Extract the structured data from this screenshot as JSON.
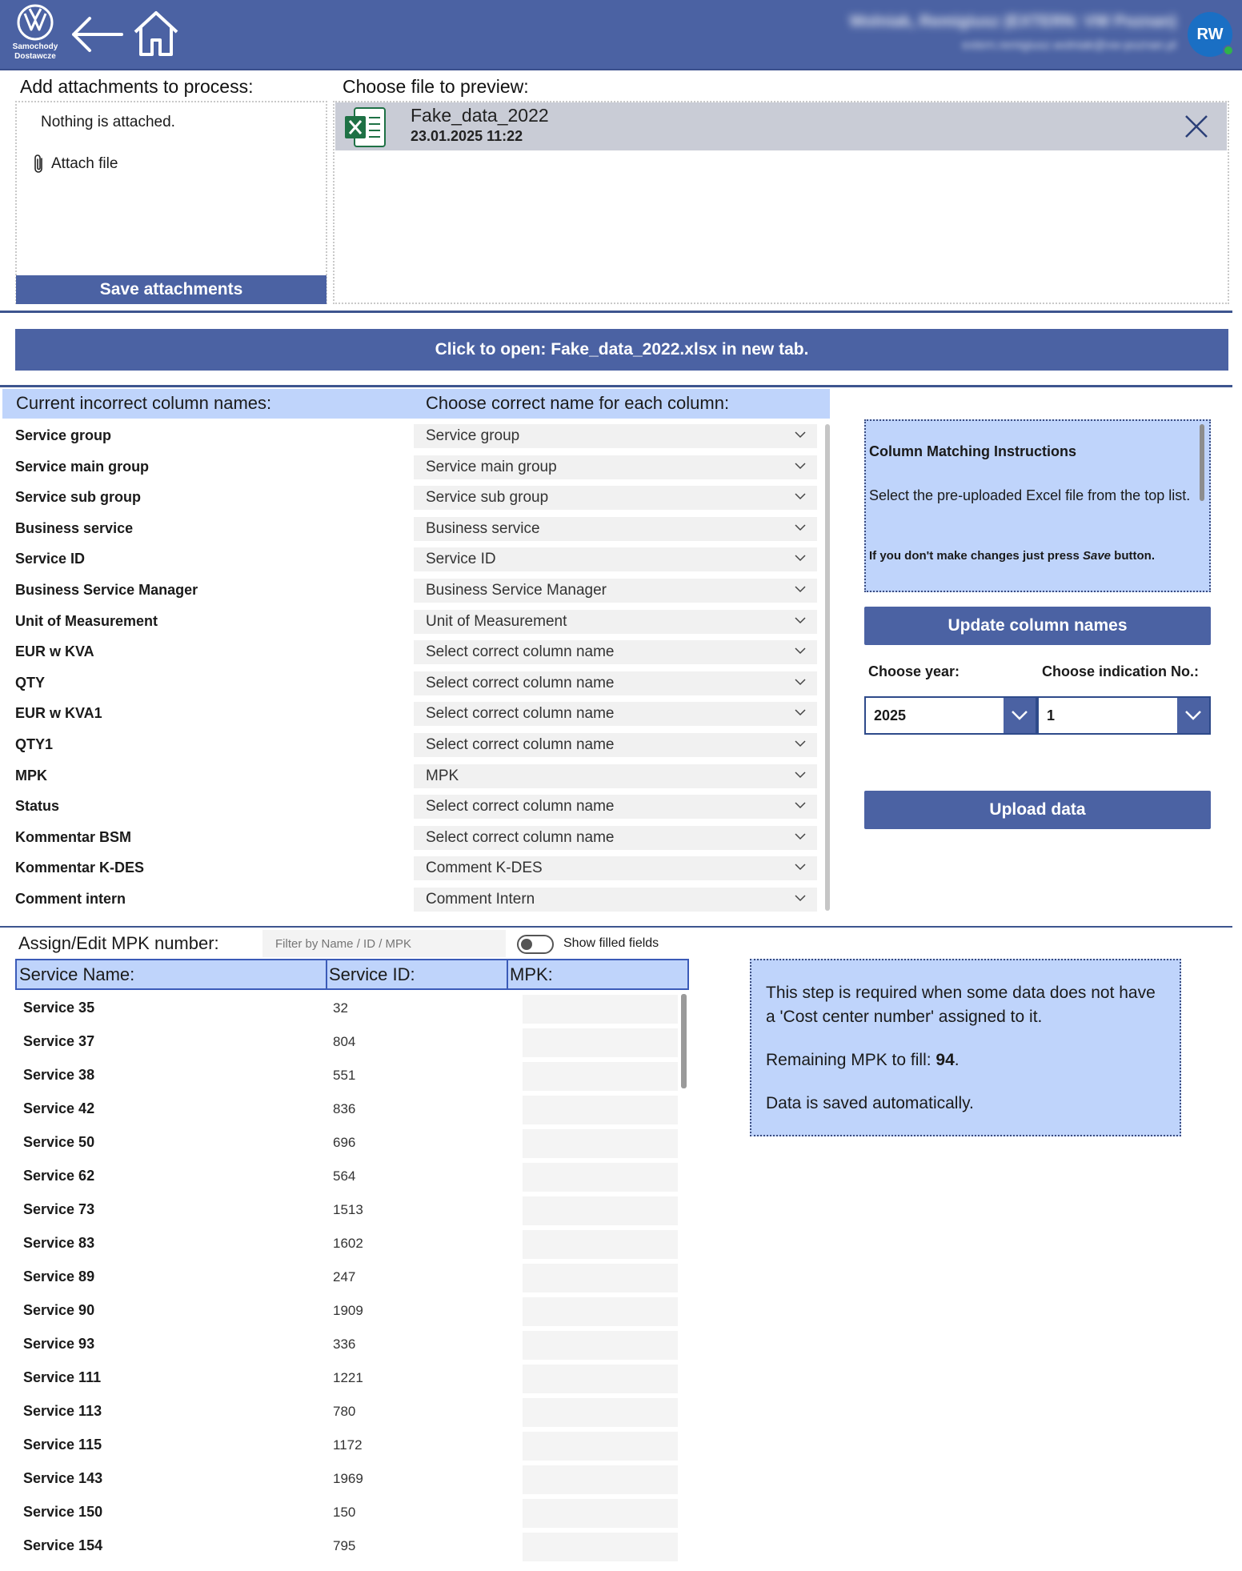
{
  "header": {
    "brand_line1": "Samochody",
    "brand_line2": "Dostawcze",
    "user_name": "Wolniak, Remigiusz (EXTERN: VW Poznan)",
    "user_email": "extern.remigiusz.wolniak@vw-poznan.pl",
    "avatar_initials": "RW",
    "color": "#4b62a3"
  },
  "attachments": {
    "label": "Add attachments to process:",
    "empty_text": "Nothing is attached.",
    "attach_label": "Attach file",
    "save_label": "Save attachments"
  },
  "preview": {
    "label": "Choose file to preview:",
    "file_name": "Fake_data_2022",
    "file_date": "23.01.2025 11:22",
    "open_button": "Click to open: Fake_data_2022.xlsx in new tab."
  },
  "mapping": {
    "header_current": "Current incorrect column names:",
    "header_choose": "Choose correct name for each column:",
    "rows": [
      {
        "current": "Service group",
        "choice": "Service group"
      },
      {
        "current": "Service main group",
        "choice": "Service main group"
      },
      {
        "current": "Service sub group",
        "choice": "Service sub group"
      },
      {
        "current": "Business service",
        "choice": "Business service"
      },
      {
        "current": "Service ID",
        "choice": "Service ID"
      },
      {
        "current": "Business Service Manager",
        "choice": "Business Service Manager"
      },
      {
        "current": "Unit of Measurement",
        "choice": "Unit of Measurement"
      },
      {
        "current": "EUR w KVA",
        "choice": "Select correct column name"
      },
      {
        "current": "QTY",
        "choice": "Select correct column name"
      },
      {
        "current": "EUR w KVA1",
        "choice": "Select correct column name"
      },
      {
        "current": "QTY1",
        "choice": "Select correct column name"
      },
      {
        "current": "MPK",
        "choice": "MPK"
      },
      {
        "current": "Status",
        "choice": "Select correct column name"
      },
      {
        "current": "Kommentar BSM",
        "choice": "Select correct column name"
      },
      {
        "current": "Kommentar K-DES",
        "choice": "Comment K-DES"
      },
      {
        "current": "Comment intern",
        "choice": "Comment Intern"
      }
    ]
  },
  "instructions": {
    "title": "Column Matching Instructions",
    "text": "Select the pre-uploaded Excel file from the top list.",
    "note_prefix": "If you don't make changes just press ",
    "note_em": "Save",
    "note_suffix": " button."
  },
  "actions": {
    "update_label": "Update column names",
    "year_label": "Choose year:",
    "year_value": "2025",
    "indication_label": "Choose indication No.:",
    "indication_value": "1",
    "upload_label": "Upload data"
  },
  "mpk": {
    "title": "Assign/Edit MPK number:",
    "filter_placeholder": "Filter by Name / ID / MPK",
    "toggle_label": "Show filled fields",
    "col_name": "Service Name:",
    "col_id": "Service ID:",
    "col_mpk": "MPK:",
    "rows": [
      {
        "name": "Service 35",
        "id": "32"
      },
      {
        "name": "Service 37",
        "id": "804"
      },
      {
        "name": "Service 38",
        "id": "551"
      },
      {
        "name": "Service 42",
        "id": "836"
      },
      {
        "name": "Service 50",
        "id": "696"
      },
      {
        "name": "Service 62",
        "id": "564"
      },
      {
        "name": "Service 73",
        "id": "1513"
      },
      {
        "name": "Service 83",
        "id": "1602"
      },
      {
        "name": "Service 89",
        "id": "247"
      },
      {
        "name": "Service 90",
        "id": "1909"
      },
      {
        "name": "Service 93",
        "id": "336"
      },
      {
        "name": "Service 111",
        "id": "1221"
      },
      {
        "name": "Service 113",
        "id": "780"
      },
      {
        "name": "Service 115",
        "id": "1172"
      },
      {
        "name": "Service 143",
        "id": "1969"
      },
      {
        "name": "Service 150",
        "id": "150"
      },
      {
        "name": "Service 154",
        "id": "795"
      }
    ]
  },
  "info": {
    "line1": "This step is required when some data does not have a 'Cost center number' assigned to it.",
    "remaining_prefix": "Remaining MPK to fill: ",
    "remaining_value": "94",
    "remaining_suffix": ".",
    "saved_text": "Data is saved automatically."
  }
}
